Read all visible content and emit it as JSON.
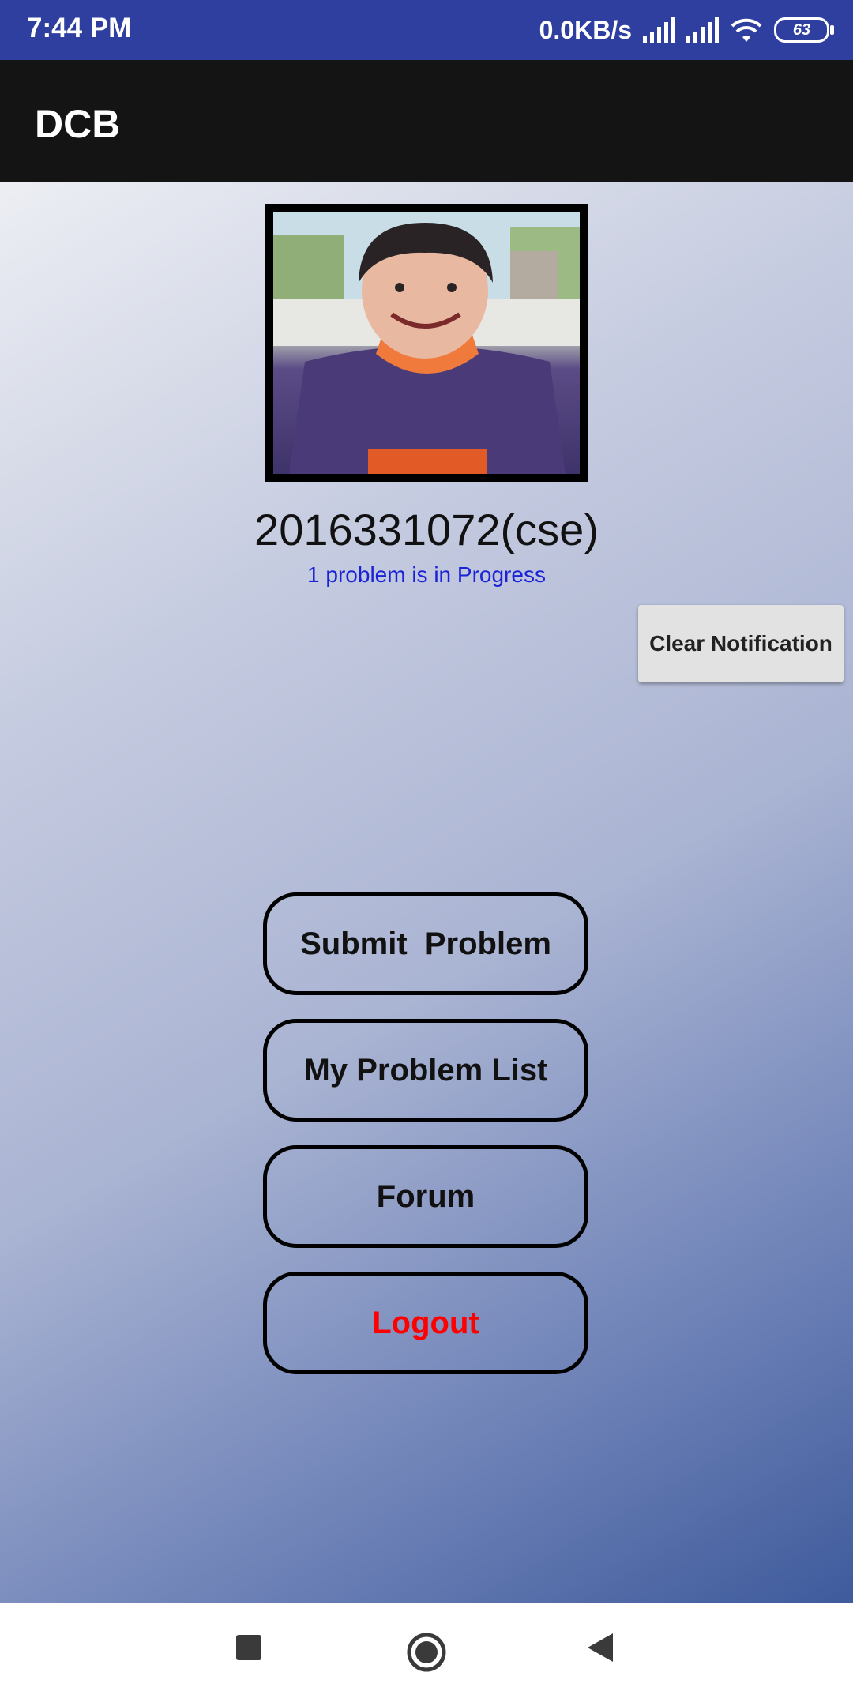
{
  "status_bar": {
    "time": "7:44 PM",
    "network_speed": "0.0KB/s",
    "battery_level": "63",
    "icons": [
      "signal-icon",
      "signal-icon",
      "wifi-icon",
      "battery-icon"
    ]
  },
  "app_bar": {
    "title": "DCB"
  },
  "profile": {
    "avatar_icon": "profile-photo",
    "user_id": "2016331072(cse)",
    "status_text": "1 problem is in Progress"
  },
  "notification": {
    "clear_label": "Clear Notification"
  },
  "menu": {
    "submit_label": "Submit  Problem",
    "my_list_label": "My Problem List",
    "forum_label": "Forum",
    "logout_label": "Logout"
  },
  "nav_bar": {
    "icons": [
      "recent-apps-icon",
      "home-icon",
      "back-icon"
    ]
  },
  "colors": {
    "status_bar": "#2f3f9f",
    "app_bar": "#141414",
    "status_text": "#1a22d6",
    "logout": "#ff0000"
  }
}
